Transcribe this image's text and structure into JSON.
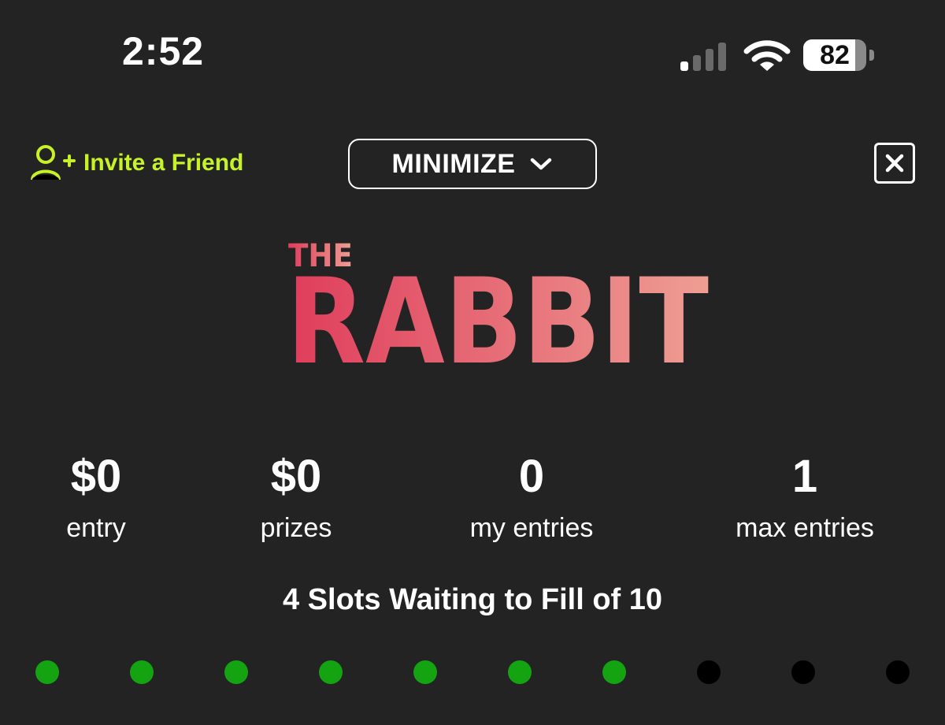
{
  "status_bar": {
    "time": "2:52",
    "battery_level": "82",
    "battery_fraction": 0.82,
    "signal_bars_active": 1,
    "signal_bars_total": 4
  },
  "header": {
    "invite_label": "Invite a Friend",
    "invite_icon": "add-user-icon",
    "minimize_label": "MINIMIZE",
    "minimize_icon": "chevron-down-icon",
    "close_icon": "close-icon"
  },
  "logo": {
    "line1": "THE",
    "line2": "RABBIT",
    "gradient_start": "#df3d5b",
    "gradient_end": "#ee9e94"
  },
  "stats": [
    {
      "value": "$0",
      "label": "entry"
    },
    {
      "value": "$0",
      "label": "prizes"
    },
    {
      "value": "0",
      "label": "my entries"
    },
    {
      "value": "1",
      "label": "max entries"
    }
  ],
  "slots": {
    "text": "4 Slots Waiting to Fill of 10",
    "total": 10,
    "filled": 7
  },
  "colors": {
    "background": "#232323",
    "accent": "#c7f227",
    "slot_filled": "#14a311",
    "slot_empty": "#000000"
  }
}
